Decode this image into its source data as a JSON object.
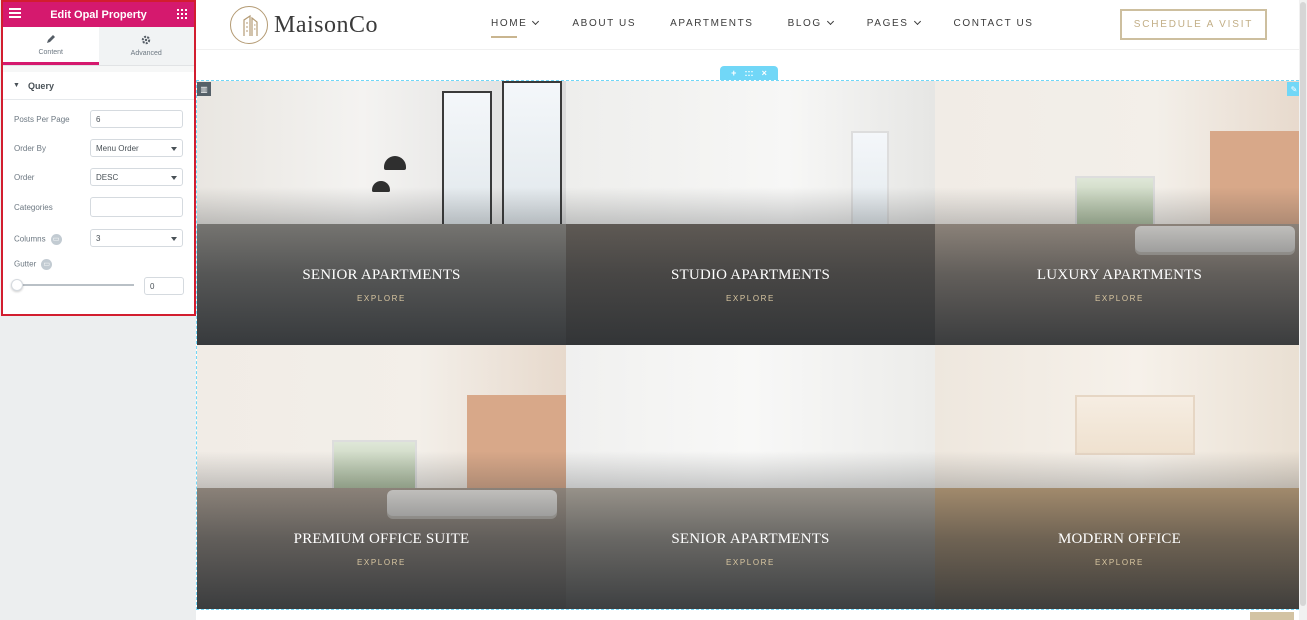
{
  "editor": {
    "title": "Edit Opal Property",
    "tabs": [
      {
        "label": "Content",
        "icon": "pencil-icon"
      },
      {
        "label": "Advanced",
        "icon": "gear-icon"
      }
    ],
    "section_title": "Query",
    "fields": {
      "posts_per_page": {
        "label": "Posts Per Page",
        "value": "6"
      },
      "order_by": {
        "label": "Order By",
        "value": "Menu Order"
      },
      "order": {
        "label": "Order",
        "value": "DESC"
      },
      "categories": {
        "label": "Categories",
        "value": ""
      },
      "columns": {
        "label": "Columns",
        "value": "3"
      },
      "gutter": {
        "label": "Gutter",
        "value": "0"
      }
    },
    "accent_color": "#d5196e"
  },
  "site": {
    "logo_text": "MaisonCo",
    "nav": [
      {
        "label": "HOME"
      },
      {
        "label": "ABOUT US"
      },
      {
        "label": "APARTMENTS"
      },
      {
        "label": "BLOG"
      },
      {
        "label": "PAGES"
      },
      {
        "label": "CONTACT US"
      }
    ],
    "cta_label": "SCHEDULE A VISIT",
    "section_controls": {
      "add": "+",
      "move": ":::",
      "close": "×"
    }
  },
  "properties": [
    {
      "title": "SENIOR APARTMENTS",
      "link": "EXPLORE"
    },
    {
      "title": "STUDIO APARTMENTS",
      "link": "EXPLORE"
    },
    {
      "title": "LUXURY APARTMENTS",
      "link": "EXPLORE"
    },
    {
      "title": "PREMIUM OFFICE SUITE",
      "link": "EXPLORE"
    },
    {
      "title": "SENIOR APARTMENTS",
      "link": "EXPLORE"
    },
    {
      "title": "MODERN OFFICE",
      "link": "EXPLORE"
    }
  ]
}
